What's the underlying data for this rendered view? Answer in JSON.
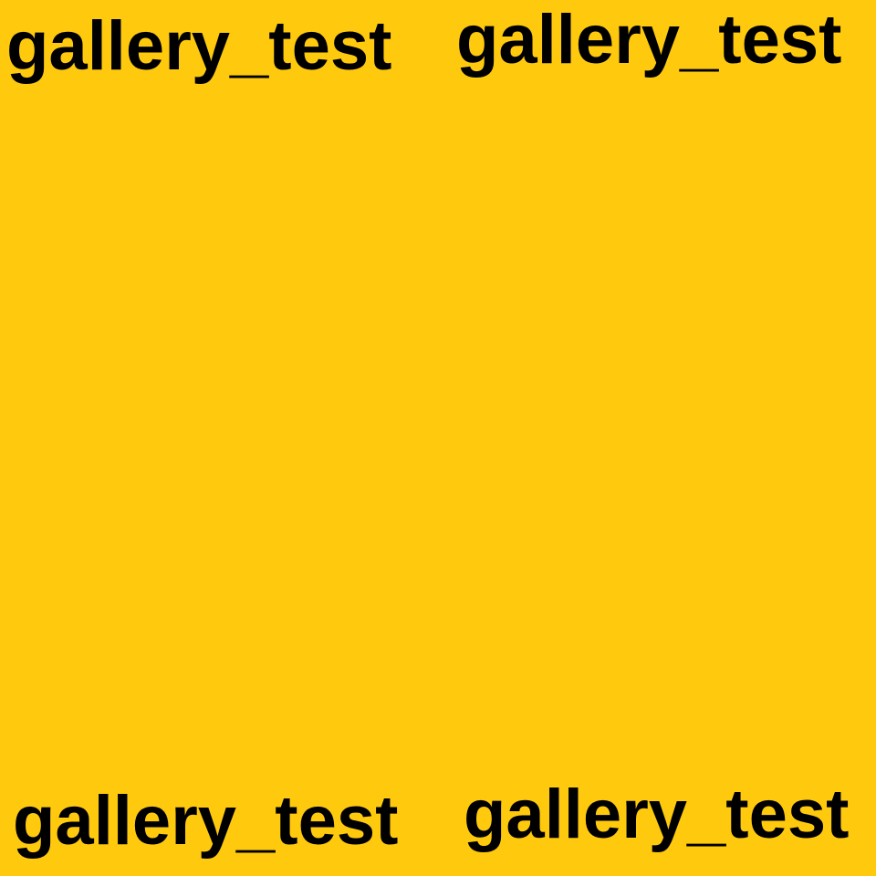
{
  "background_color": "#FFC90E",
  "text_color": "#000000",
  "labels": {
    "top_left": "gallery_test",
    "top_right": "gallery_test",
    "bottom_left": "gallery_test",
    "bottom_right": "gallery_test"
  }
}
